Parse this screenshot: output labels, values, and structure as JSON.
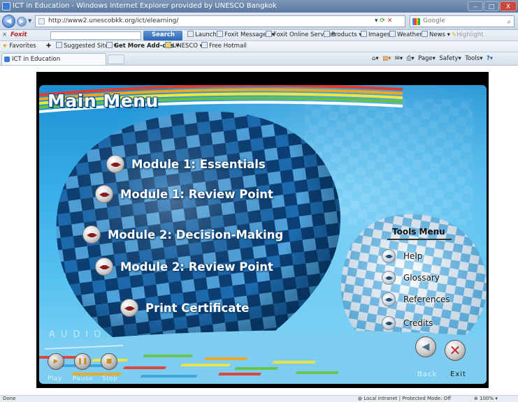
{
  "browser": {
    "title": "ICT in Education - Windows Internet Explorer provided by UNESCO Bangkok",
    "url": "http://www2.unescobkk.org/ict/elearning/",
    "search_placeholder": "Google",
    "window_buttons": {
      "minimize": "–",
      "maximize": "□",
      "close": "X"
    },
    "foxit_toolbar": {
      "logo": "Foxit",
      "search_label": "Search",
      "items": [
        "Launch",
        "Foxit Messages",
        "Foxit Online Services",
        "Products",
        "Images",
        "Weather",
        "News",
        "Highlight"
      ]
    },
    "favorites_bar": {
      "favorites_label": "Favorites",
      "items": [
        "Suggested Sites",
        "Get More Add-ons",
        "UNESCO",
        "Free Hotmail"
      ]
    },
    "tab": {
      "title": "ICT in Education"
    },
    "command_bar": [
      "Page",
      "Safety",
      "Tools"
    ],
    "status": {
      "left": "Done",
      "zone": "Local intranet | Protected Mode: Off",
      "zoom": "100%"
    }
  },
  "app": {
    "title": "Main Menu",
    "menu_items": [
      "Module 1: Essentials",
      "Module 1: Review Point",
      "Module 2: Decision-Making",
      "Module 2: Review Point",
      "Print Certificate"
    ],
    "tools_menu": {
      "title": "Tools Menu",
      "items": [
        "Help",
        "Glossary",
        "References",
        "Credits"
      ]
    },
    "audio": {
      "label": "AUDIO",
      "play_label": "Play",
      "pause_label": "Pause",
      "stop_label": "Stop"
    },
    "nav": {
      "back_label": "Back",
      "exit_label": "Exit"
    },
    "colors": {
      "sky_top": "#1e8fd2",
      "sky_bottom": "#8fd6f5",
      "balloon_dark": "#0f4c86",
      "balloon_light": "#67b4e6",
      "orb_accent": "#8c1a1a",
      "exit_accent": "#c0282d"
    }
  }
}
